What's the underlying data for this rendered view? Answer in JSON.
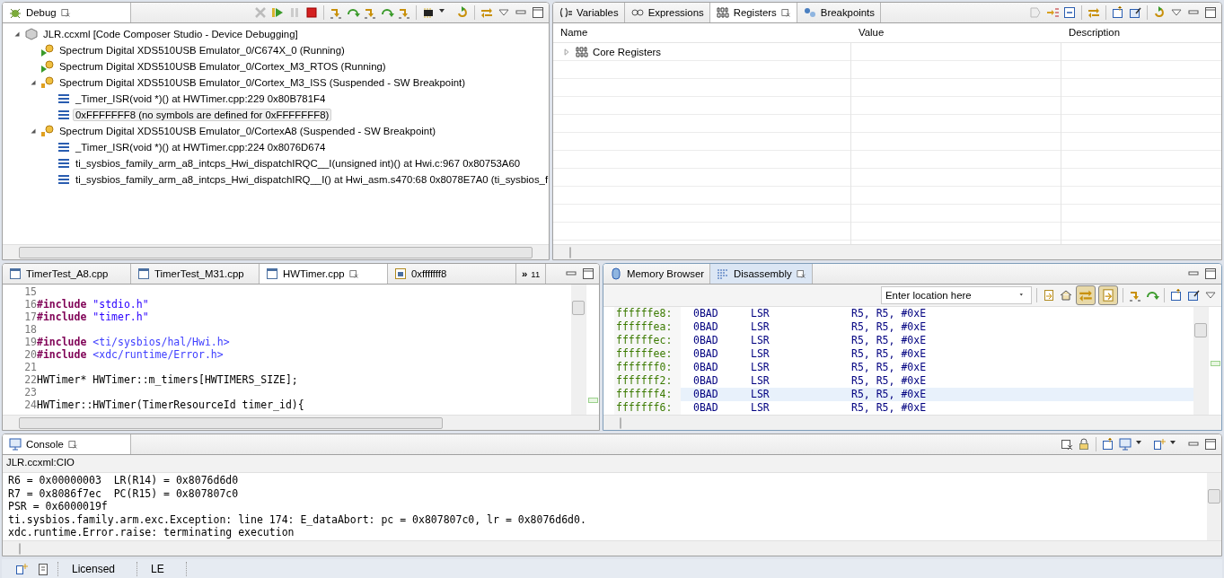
{
  "debug_view": {
    "tabs": [
      {
        "label": "Debug",
        "kind": "debug",
        "selected": true
      }
    ],
    "tree": [
      {
        "label": "JLR.ccxml [Code Composer Studio - Device Debugging]",
        "kind": "launch",
        "expanded": true,
        "selected": false,
        "children": [
          {
            "label": "Spectrum Digital XDS510USB Emulator_0/C674X_0 (Running)",
            "kind": "running",
            "selected": false
          },
          {
            "label": "Spectrum Digital XDS510USB Emulator_0/Cortex_M3_RTOS (Running)",
            "kind": "running",
            "selected": false
          },
          {
            "label": "Spectrum Digital XDS510USB Emulator_0/Cortex_M3_ISS (Suspended - SW Breakpoint)",
            "kind": "suspended",
            "expanded": true,
            "selected": false,
            "children": [
              {
                "label": "_Timer_ISR(void *)() at HWTimer.cpp:229 0x80B781F4",
                "kind": "frame",
                "selected": false
              },
              {
                "label": "0xFFFFFFF8  (no symbols are defined for 0xFFFFFFF8)",
                "kind": "frame",
                "selected": true
              }
            ]
          },
          {
            "label": "Spectrum Digital XDS510USB Emulator_0/CortexA8 (Suspended - SW Breakpoint)",
            "kind": "suspended",
            "expanded": true,
            "selected": false,
            "children": [
              {
                "label": "_Timer_ISR(void *)() at HWTimer.cpp:224 0x8076D674",
                "kind": "frame",
                "selected": false
              },
              {
                "label": "ti_sysbios_family_arm_a8_intcps_Hwi_dispatchIRQC__I(unsigned int)() at Hwi.c:967 0x80753A60",
                "kind": "frame",
                "selected": false
              },
              {
                "label": "ti_sysbios_family_arm_a8_intcps_Hwi_dispatchIRQ__I() at Hwi_asm.s470:68 0x8078E7A0  (ti_sysbios_f",
                "kind": "frame",
                "selected": false
              }
            ]
          }
        ]
      }
    ]
  },
  "registers_view": {
    "tabs": [
      {
        "label": "Variables",
        "kind": "variables",
        "selected": false
      },
      {
        "label": "Expressions",
        "kind": "expressions",
        "selected": false
      },
      {
        "label": "Registers",
        "kind": "registers",
        "selected": true
      },
      {
        "label": "Breakpoints",
        "kind": "breakpoints",
        "selected": false
      }
    ],
    "columns": [
      "Name",
      "Value",
      "Description"
    ],
    "rows": [
      {
        "name": "Core Registers",
        "expanded": false
      }
    ]
  },
  "editor": {
    "tabs": [
      {
        "label": "TimerTest_A8.cpp",
        "kind": "source",
        "selected": false
      },
      {
        "label": "TimerTest_M31.cpp",
        "kind": "source",
        "selected": false
      },
      {
        "label": "HWTimer.cpp",
        "kind": "source",
        "selected": true
      },
      {
        "label": "0xfffffff8",
        "kind": "assembly",
        "selected": false
      }
    ],
    "overflow": {
      "glyph": "»",
      "count": "11"
    },
    "lines": [
      {
        "number": "15"
      },
      {
        "number": "16",
        "parts": [
          {
            "kind": "directive",
            "text": "#include"
          },
          {
            "kind": "string",
            "text": " \"stdio.h\""
          }
        ]
      },
      {
        "number": "17",
        "parts": [
          {
            "kind": "directive",
            "text": "#include"
          },
          {
            "kind": "string",
            "text": " \"timer.h\""
          }
        ]
      },
      {
        "number": "18"
      },
      {
        "number": "19",
        "parts": [
          {
            "kind": "directive",
            "text": "#include"
          },
          {
            "kind": "header",
            "text": " <ti/sysbios/hal/Hwi.h>"
          }
        ]
      },
      {
        "number": "20",
        "parts": [
          {
            "kind": "directive",
            "text": "#include"
          },
          {
            "kind": "header",
            "text": " <xdc/runtime/Error.h>"
          }
        ]
      },
      {
        "number": "21"
      },
      {
        "number": "22",
        "parts": [
          {
            "kind": "plain",
            "text": "HWTimer* HWTimer::m_timers[HWTIMERS_SIZE];"
          }
        ]
      },
      {
        "number": "23"
      },
      {
        "number": "24",
        "parts": [
          {
            "kind": "plain",
            "text": "HWTimer::HWTimer(TimerResourceId timer_id){"
          }
        ]
      }
    ]
  },
  "disassembly_view": {
    "tabs": [
      {
        "label": "Memory Browser",
        "kind": "memory",
        "selected": false
      },
      {
        "label": "Disassembly",
        "kind": "disassembly",
        "selected": true
      }
    ],
    "location_field": {
      "placeholder": "Enter location here"
    },
    "toggle_buttons": [
      {
        "on": true
      },
      {
        "on": true
      }
    ],
    "rows": [
      {
        "address": "ffffffe8:",
        "opcode": "0BAD",
        "mnemonic": "LSR",
        "operands": "R5, R5, #0xE",
        "selected": false
      },
      {
        "address": "ffffffea:",
        "opcode": "0BAD",
        "mnemonic": "LSR",
        "operands": "R5, R5, #0xE",
        "selected": false
      },
      {
        "address": "ffffffec:",
        "opcode": "0BAD",
        "mnemonic": "LSR",
        "operands": "R5, R5, #0xE",
        "selected": false
      },
      {
        "address": "ffffffee:",
        "opcode": "0BAD",
        "mnemonic": "LSR",
        "operands": "R5, R5, #0xE",
        "selected": false
      },
      {
        "address": "fffffff0:",
        "opcode": "0BAD",
        "mnemonic": "LSR",
        "operands": "R5, R5, #0xE",
        "selected": false
      },
      {
        "address": "fffffff2:",
        "opcode": "0BAD",
        "mnemonic": "LSR",
        "operands": "R5, R5, #0xE",
        "selected": false
      },
      {
        "address": "fffffff4:",
        "opcode": "0BAD",
        "mnemonic": "LSR",
        "operands": "R5, R5, #0xE",
        "selected": true
      },
      {
        "address": "fffffff6:",
        "opcode": "0BAD",
        "mnemonic": "LSR",
        "operands": "R5, R5, #0xE",
        "selected": false
      }
    ]
  },
  "console_view": {
    "tabs": [
      {
        "label": "Console",
        "kind": "console",
        "selected": true
      }
    ],
    "title": "JLR.ccxml:CIO",
    "lines": [
      "R6 = 0x00000003  LR(R14) = 0x8076d6d0",
      "R7 = 0x8086f7ec  PC(R15) = 0x807807c0",
      "PSR = 0x6000019f",
      "ti.sysbios.family.arm.exc.Exception: line 174: E_dataAbort: pc = 0x807807c0, lr = 0x8076d6d0.",
      "xdc.runtime.Error.raise: terminating execution"
    ]
  },
  "status_bar": {
    "items": [
      "Licensed",
      "LE"
    ]
  }
}
